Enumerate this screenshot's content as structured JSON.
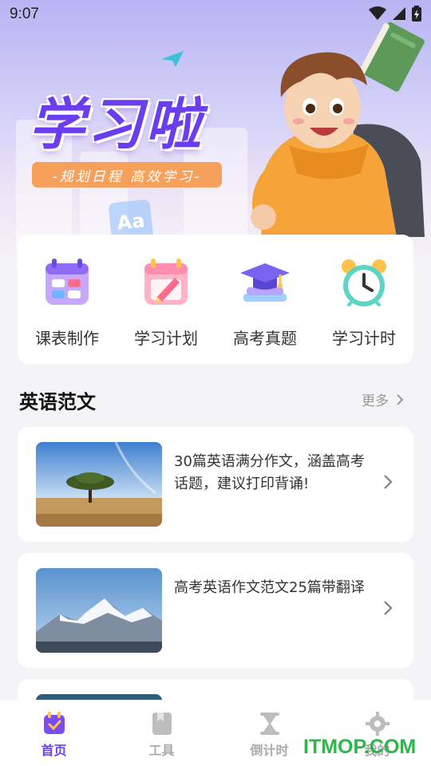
{
  "status_bar": {
    "time": "9:07"
  },
  "hero": {
    "title": "学习啦",
    "subtitle": "-规划日程 高效学习-",
    "card_text": "Aa"
  },
  "tools": [
    {
      "label": "课表制作",
      "icon": "schedule-icon"
    },
    {
      "label": "学习计划",
      "icon": "study-plan-icon"
    },
    {
      "label": "高考真题",
      "icon": "graduation-cap-icon"
    },
    {
      "label": "学习计时",
      "icon": "alarm-clock-icon"
    }
  ],
  "section": {
    "title": "英语范文",
    "more_label": "更多"
  },
  "articles": [
    {
      "title": "30篇英语满分作文，涵盖高考话题，建议打印背诵!",
      "image": "savanna-tree-photo"
    },
    {
      "title": "高考英语作文范文25篇带翻译",
      "image": "snow-mountain-photo"
    }
  ],
  "bottom_nav": [
    {
      "label": "首页",
      "icon": "home-calendar-icon",
      "active": true
    },
    {
      "label": "工具",
      "icon": "tool-box-icon",
      "active": false
    },
    {
      "label": "倒计时",
      "icon": "hourglass-icon",
      "active": false
    },
    {
      "label": "我的",
      "icon": "gear-icon",
      "active": false
    }
  ],
  "watermark": "ITMOP.COM",
  "colors": {
    "accent": "#6b3df0",
    "pill": "#f6a15b",
    "background": "#f4f4f6"
  }
}
